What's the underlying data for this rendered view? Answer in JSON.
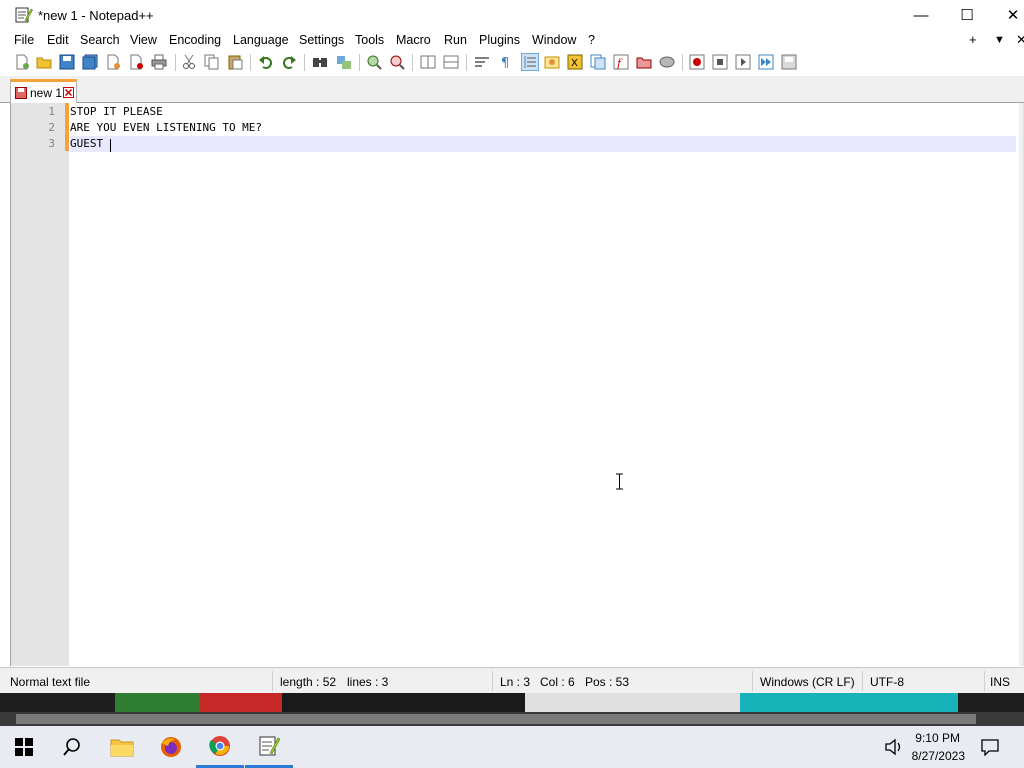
{
  "window": {
    "title": "*new 1 - Notepad++",
    "minimize": "—",
    "maximize": "☐",
    "close": "✕"
  },
  "menu": {
    "items": [
      "File",
      "Edit",
      "Search",
      "View",
      "Encoding",
      "Language",
      "Settings",
      "Tools",
      "Macro",
      "Run",
      "Plugins",
      "Window",
      "?"
    ],
    "right": [
      "+",
      "▼",
      "✕"
    ]
  },
  "tabs": [
    {
      "label": "new 1",
      "modified": true
    }
  ],
  "editor": {
    "lines": [
      {
        "number": "1",
        "text": "STOP IT PLEASE"
      },
      {
        "number": "2",
        "text": "ARE YOU EVEN LISTENING TO ME?"
      },
      {
        "number": "3",
        "text": "GUEST"
      }
    ],
    "current_line": 3
  },
  "status": {
    "file_type": "Normal text file",
    "length": "length : 52",
    "lines": "lines : 3",
    "ln": "Ln : 3",
    "col": "Col : 6",
    "pos": "Pos : 53",
    "eol": "Windows (CR LF)",
    "encoding": "UTF-8",
    "mode": "INS"
  },
  "taskbar": {
    "apps": [
      "start-button",
      "search-button",
      "file-explorer",
      "firefox",
      "chrome",
      "notepad-plus-plus"
    ],
    "time": "9:10 PM",
    "date": "8/27/2023"
  },
  "colors": {
    "accent_tab": "#f7a13b",
    "current_line": "#e8e8ff",
    "taskbar_active": "#2a7ad6"
  }
}
